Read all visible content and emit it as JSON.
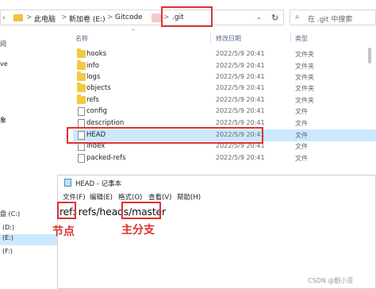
{
  "address_bar": {
    "crumbs": [
      "此电脑",
      "新加卷 (E:)",
      "Gitcode",
      ".git"
    ],
    "separator": ">"
  },
  "search": {
    "placeholder": "在 .git 中搜索"
  },
  "nav_fragments": [
    "问",
    "ve",
    "象",
    "盘 (C:)",
    "(D:)",
    "(E:)",
    "(F:)"
  ],
  "columns": {
    "name": "名称",
    "modified": "修改日期",
    "type": "类型"
  },
  "files": [
    {
      "name": "hooks",
      "kind": "folder",
      "date": "2022/5/9 20:41",
      "type": "文件夹"
    },
    {
      "name": "info",
      "kind": "folder",
      "date": "2022/5/9 20:41",
      "type": "文件夹"
    },
    {
      "name": "logs",
      "kind": "folder",
      "date": "2022/5/9 20:41",
      "type": "文件夹"
    },
    {
      "name": "objects",
      "kind": "folder",
      "date": "2022/5/9 20:41",
      "type": "文件夹"
    },
    {
      "name": "refs",
      "kind": "folder",
      "date": "2022/5/9 20:41",
      "type": "文件夹"
    },
    {
      "name": "config",
      "kind": "file",
      "date": "2022/5/9 20:41",
      "type": "文件"
    },
    {
      "name": "description",
      "kind": "file",
      "date": "2022/5/9 20:41",
      "type": "文件"
    },
    {
      "name": "HEAD",
      "kind": "file",
      "date": "2022/5/9 20:41",
      "type": "文件"
    },
    {
      "name": "index",
      "kind": "file",
      "date": "2022/5/9 20:41",
      "type": "文件"
    },
    {
      "name": "packed-refs",
      "kind": "file",
      "date": "2022/5/9 20:41",
      "type": "文件"
    }
  ],
  "selected_file": "HEAD",
  "notepad": {
    "title": "HEAD - 记事本",
    "menu": [
      "文件(F)",
      "编辑(E)",
      "格式(O)",
      "查看(V)",
      "帮助(H)"
    ],
    "content": "ref: refs/heads/master"
  },
  "annotations": {
    "node_label": "节点",
    "branch_label": "主分支"
  },
  "watermark": "CSDN @酷小亚",
  "colors": {
    "highlight_red": "#e03030",
    "selection_blue": "#cce8ff",
    "folder_yellow": "#f3c842"
  }
}
